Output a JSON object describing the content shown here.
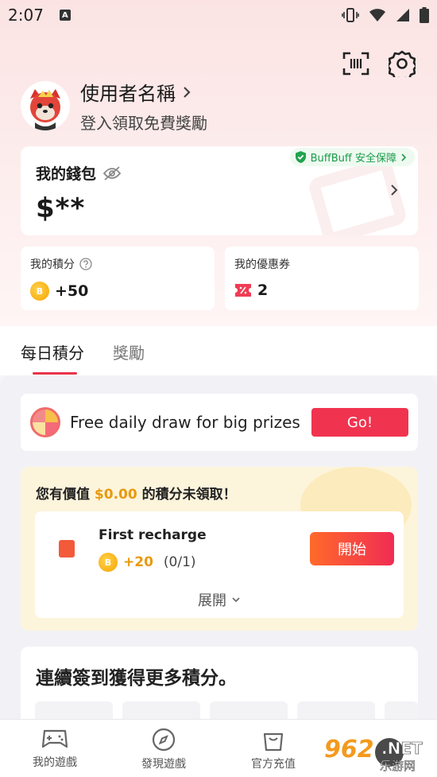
{
  "status_bar": {
    "time": "2:07",
    "notif_letter": "A"
  },
  "header": {
    "scan_icon": "scan-icon",
    "settings_icon": "gear-icon"
  },
  "profile": {
    "username": "使用者名稱",
    "subtitle": "登入領取免費獎勵"
  },
  "wallet": {
    "title": "我的錢包",
    "balance": "$**",
    "safety_badge": "BuffBuff 安全保障"
  },
  "points": {
    "title": "我的積分",
    "value": "+50"
  },
  "coupons": {
    "title": "我的優惠券",
    "value": "2"
  },
  "tabs": [
    {
      "label": "每日積分",
      "active": true
    },
    {
      "label": "獎勵",
      "active": false
    }
  ],
  "draw": {
    "text": "Free daily draw for big prizes",
    "button": "Go!"
  },
  "unclaimed": {
    "prefix": "您有價值",
    "amount": "$0.00",
    "suffix": "的積分未領取！",
    "task": {
      "title": "First recharge",
      "reward": "+20",
      "progress": "(0/1)",
      "button": "開始"
    },
    "expand": "展開"
  },
  "signin": {
    "title": "連續簽到獲得更多積分。"
  },
  "bottom_nav": [
    {
      "label": "我的遊戲",
      "icon": "gamepad-icon"
    },
    {
      "label": "發現遊戲",
      "icon": "compass-icon"
    },
    {
      "label": "官方充值",
      "icon": "shopping-bag-icon"
    }
  ],
  "watermark": {
    "text": "962",
    "domain": ".NET",
    "sub": "乐游网"
  },
  "colors": {
    "accent": "#f0344f",
    "gold": "#e89a0c",
    "safe_green": "#1a9a4a"
  }
}
